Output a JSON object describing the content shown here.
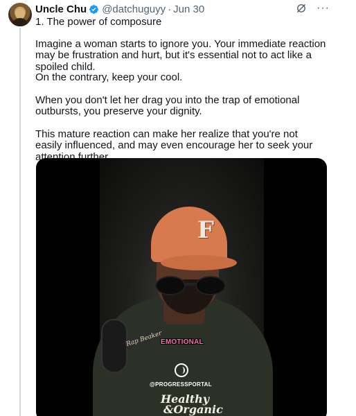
{
  "tweet": {
    "author_name": "Uncle Chu",
    "handle": "@datchuguyy",
    "separator": "·",
    "date": "Jun 30",
    "paragraphs": [
      "1. The power of composure",
      "Imagine a woman starts to ignore you. Your immediate reaction may be frustration and hurt, but it's essential not to act like a spoiled child.",
      "On the contrary, keep your cool.",
      "When you don't let her drag you into the trap of emotional outbursts, you preserve your dignity.",
      "This mature reaction can make her realize that you're not easily influenced, and may even encourage her to seek your attention further."
    ],
    "more_label": "···"
  },
  "media": {
    "mic_tag": "Rap Beaker",
    "caption": "EMOTIONAL",
    "portal_text": "@PROGRESSPORTAL",
    "logo_line1": "Healthy",
    "logo_line2": "&Organic"
  },
  "colors": {
    "verified_blue": "#1d9bf0",
    "secondary_text": "#536471",
    "caption_pink": "#ff6fb0"
  },
  "icons": [
    "verified-badge-icon",
    "grok-icon",
    "more-icon",
    "progress-portal-icon"
  ]
}
